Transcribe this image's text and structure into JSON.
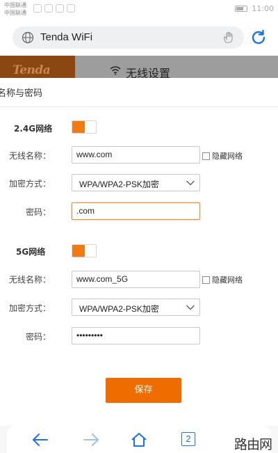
{
  "status_bar": {
    "carrier_1": "中国联通",
    "carrier_2": "中国联通",
    "time": "11:00"
  },
  "browser": {
    "url_text": "Tenda WiFi",
    "tab_count": "2"
  },
  "router_header": {
    "logo": "Tenda",
    "title": "无线设置"
  },
  "panel": {
    "title": "名称与密码",
    "save_label": "保存"
  },
  "band_24g": {
    "label": "2.4G网络",
    "enabled": true,
    "ssid_label": "无线名称：",
    "ssid_value": "www.com",
    "hide_label": "隐藏网络",
    "hide_checked": false,
    "security_label": "加密方式：",
    "security_value": "WPA/WPA2-PSK加密",
    "password_label": "密码：",
    "password_value": ".com"
  },
  "band_5g": {
    "label": "5G网络",
    "enabled": true,
    "ssid_label": "无线名称：",
    "ssid_value": "www.com_5G",
    "hide_label": "隐藏网络",
    "hide_checked": false,
    "security_label": "加密方式：",
    "security_value": "WPA/WPA2-PSK加密",
    "password_label": "密码：",
    "password_value": "•••••••••"
  },
  "watermark": "路由网",
  "icons": {
    "globe": "globe-icon",
    "hand": "hand-icon",
    "refresh": "refresh-icon",
    "wifi": "wifi-icon",
    "chevron": "chevron-down-icon",
    "back": "back-arrow-icon",
    "forward": "forward-arrow-icon",
    "home": "home-icon"
  },
  "colors": {
    "accent": "#ef6c00",
    "browser_blue": "#1a73e8",
    "logo_bg": "#8a4712"
  }
}
